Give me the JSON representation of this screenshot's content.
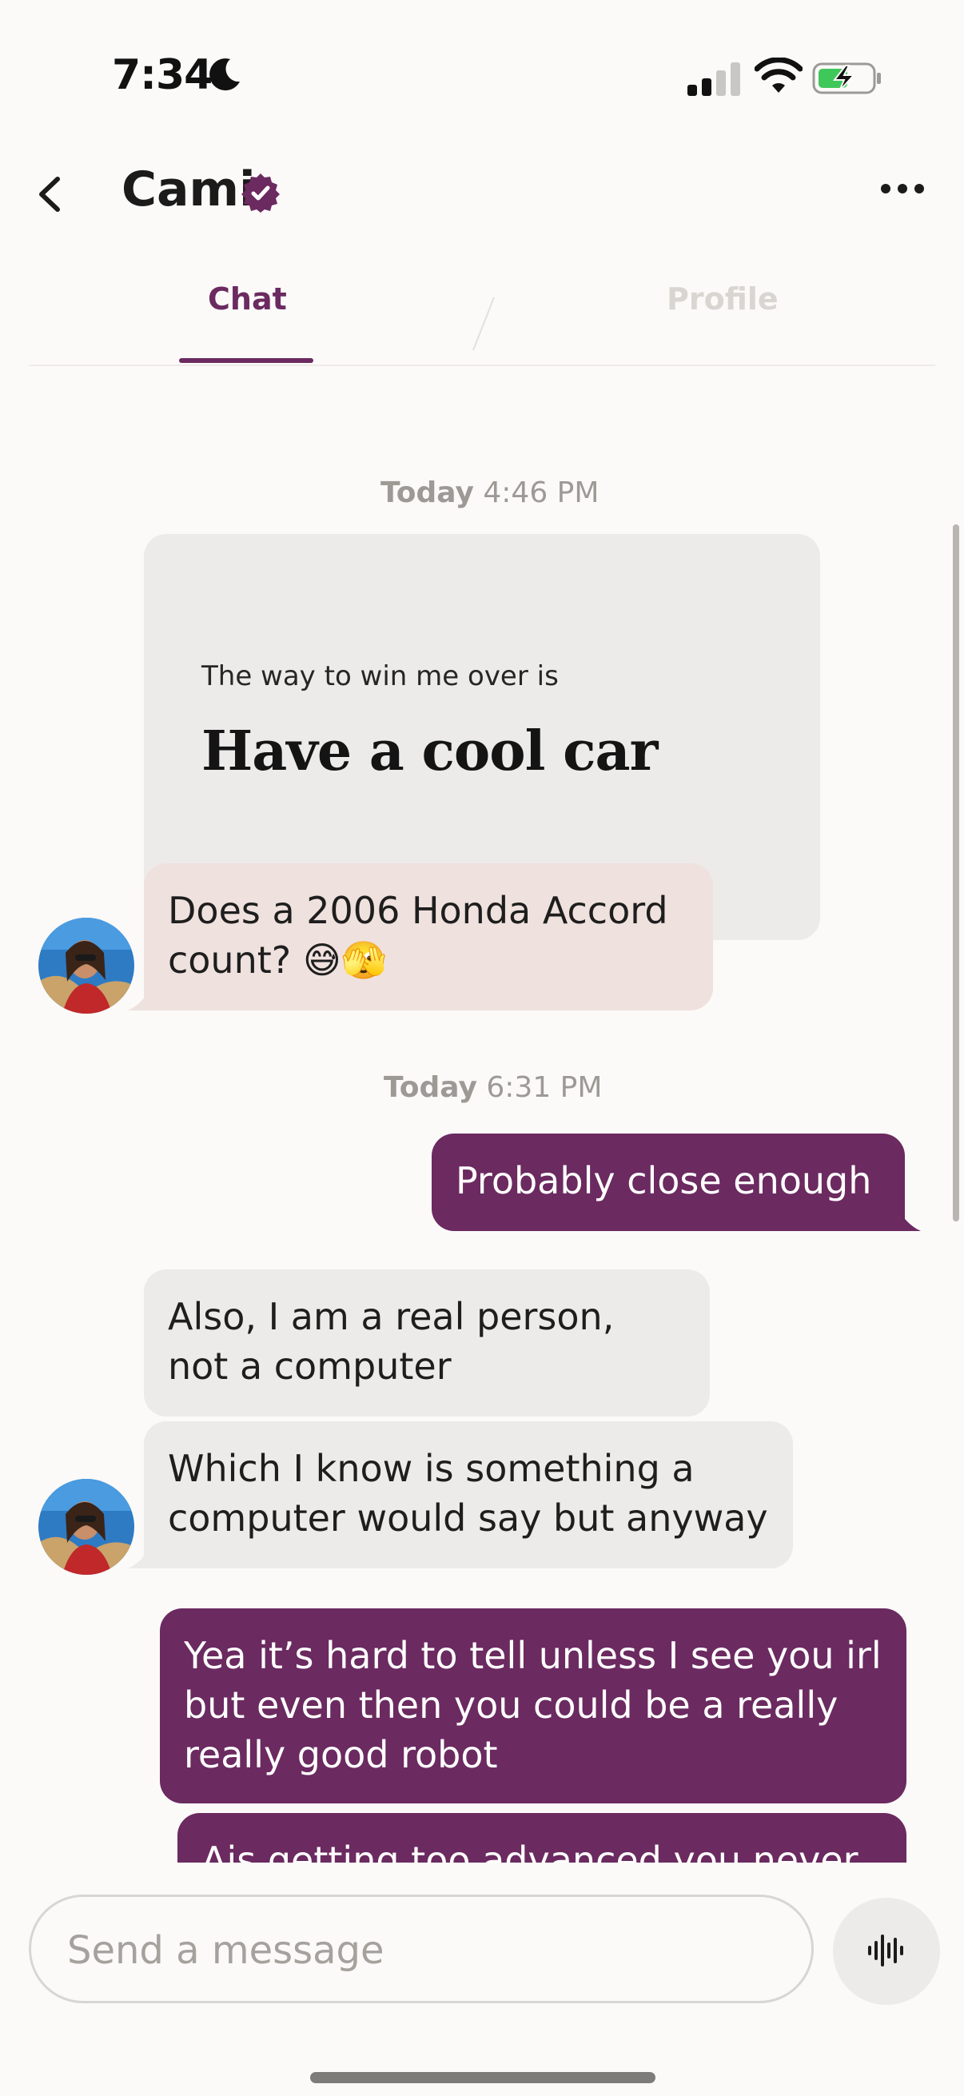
{
  "status_bar": {
    "time": "7:34"
  },
  "header": {
    "name": "Cami"
  },
  "tabs": [
    {
      "label": "Chat"
    },
    {
      "label": "Profile"
    }
  ],
  "messages": {
    "timestamp1": {
      "day": "Today",
      "time": "4:46 PM"
    },
    "prompt": {
      "question": "The way to win me over is",
      "answer": "Have a cool car"
    },
    "reply1": "Does a 2006 Honda Accord count? 😅🫣",
    "timestamp2": {
      "day": "Today",
      "time": "6:31 PM"
    },
    "sent1": "Probably close enough",
    "received1": "Also, I am a real person, not a computer",
    "received2": "Which I know is something a computer would say but anyway",
    "sent2": "Yea it’s hard to tell unless I see you irl but even then you could be a really really good robot",
    "sent3": "Ais getting too advanced you never"
  },
  "composer": {
    "placeholder": "Send a message"
  },
  "colors": {
    "accent": "#6B2A60",
    "incoming_bubble": "#ECEBEA",
    "prompt_reply_bubble": "#EFE1DD"
  },
  "icons": {
    "back": "chevron-left-icon",
    "verified": "verified-badge-icon",
    "more": "more-horizontal-icon",
    "voice": "voice-waveform-icon"
  }
}
